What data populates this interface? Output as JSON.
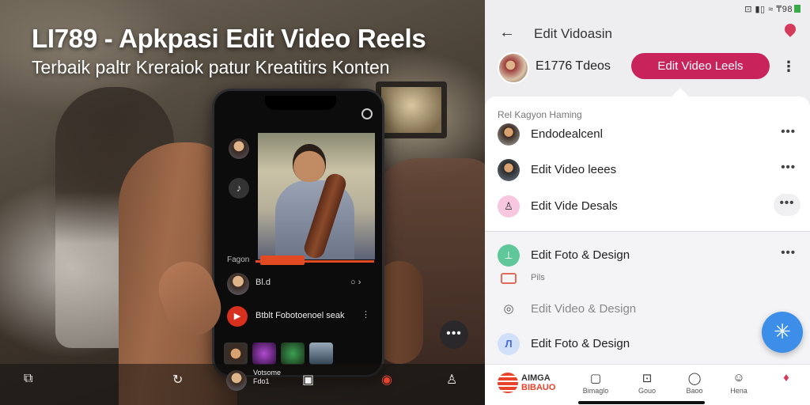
{
  "promo": {
    "title": "LI789 - Apkpasi Edit Video Reels",
    "subtitle": "Terbaik paltr Kreraiok patur Kreatitirs Konten",
    "phone": {
      "label": "Fagon",
      "row1_text": "Bl.d",
      "row2_text": "Btblt  Fobotoenoel seak",
      "more": "⋮"
    },
    "bottom_bar": {
      "tiny_text": "Votsome\nFdo1"
    }
  },
  "status_bar": {
    "text": "⊡  ▮▯  ≈  ₸98"
  },
  "app": {
    "title": "Edit Vidoasin",
    "profile_name": "E1776 Tdeos",
    "primary_button": "Edit Video Leels",
    "section_label": "Rel Kagyon Haming",
    "items": [
      {
        "label": "Endodealcenl"
      },
      {
        "label": "Edit Video leees"
      },
      {
        "label": "Edit Vide Desals"
      }
    ],
    "lower_items": [
      {
        "label": "Edit Foto & Design"
      },
      {
        "label": "Pils"
      },
      {
        "label": "Edit Video & Design"
      },
      {
        "label": "Edit Foto & Design"
      }
    ],
    "more": "•••",
    "fab_icon": "✳"
  },
  "bottom_nav": {
    "brand_top": "AIMGA",
    "brand_bottom": "BIBAUO",
    "items": [
      {
        "label": "Bimaglo",
        "icon": "▢"
      },
      {
        "label": "Gouo",
        "icon": "⊡"
      },
      {
        "label": "Baoo",
        "icon": "◯"
      },
      {
        "label": "Hena",
        "icon": "☺"
      },
      {
        "label": "",
        "icon": "♦"
      }
    ]
  },
  "colors": {
    "accent": "#c8235a",
    "fab": "#3c8ee8",
    "brand": "#e8432a"
  }
}
